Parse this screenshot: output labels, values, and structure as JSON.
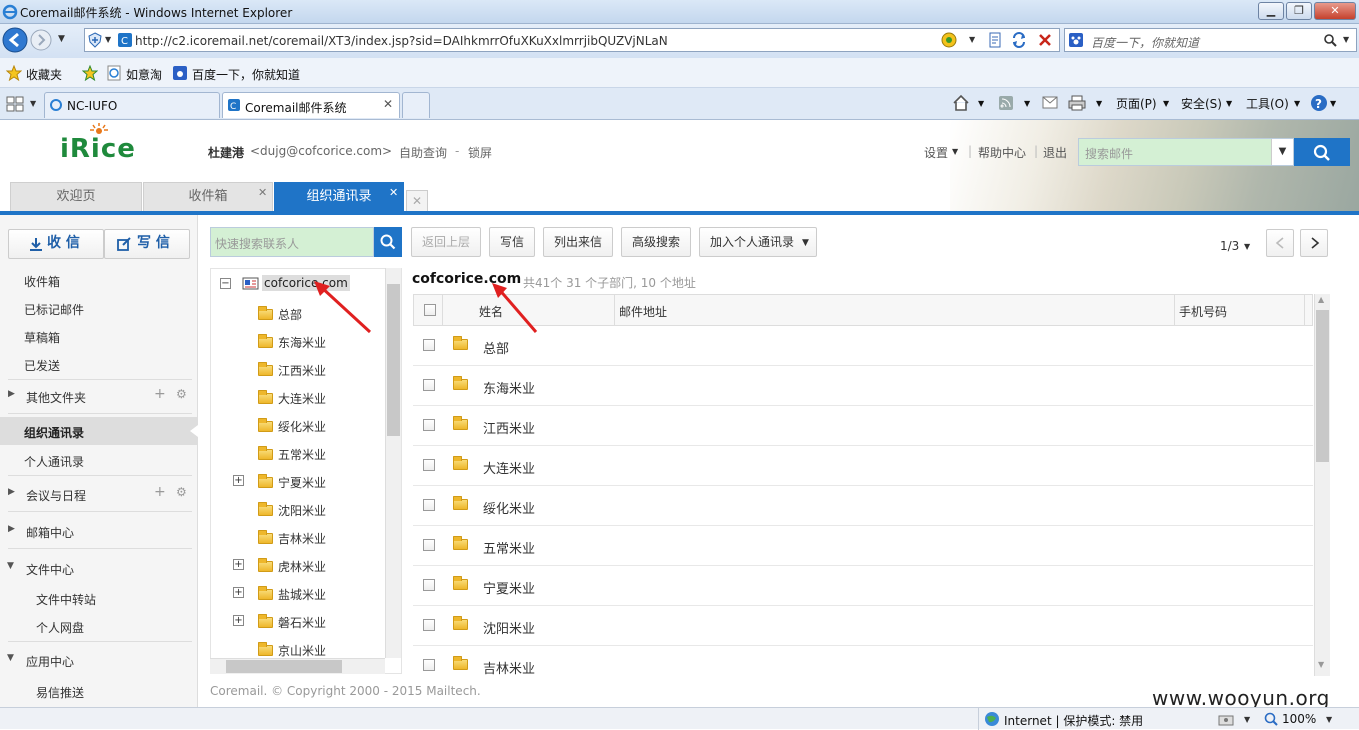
{
  "window": {
    "title": "Coremail邮件系统 - Windows Internet Explorer"
  },
  "browser": {
    "url": "http://c2.icoremail.net/coremail/XT3/index.jsp?sid=DAIhkmrrOfuXKuXxlmrrjibQUZVjNLaN",
    "search_placeholder": "百度一下，你就知道",
    "favorites_label": "收藏夹",
    "fav_links": [
      "如意淘",
      "百度一下，你就知道"
    ],
    "tabs": [
      "NC-IUFO",
      "Coremail邮件系统"
    ],
    "tools": [
      "页面(P)",
      "安全(S)",
      "工具(O)"
    ]
  },
  "header": {
    "logo": "iRice",
    "user_name": "杜建港",
    "user_email": "<dujg@cofcorice.com>",
    "self_help": "自助查询",
    "dash": "-",
    "lock": "锁屏",
    "settings": "设置",
    "help": "帮助中心",
    "logout": "退出",
    "search_placeholder": "搜索邮件"
  },
  "app_tabs": [
    "欢迎页",
    "收件箱",
    "组织通讯录"
  ],
  "sidebar": {
    "receive": "收 信",
    "compose": "写 信",
    "folders": [
      "收件箱",
      "已标记邮件",
      "草稿箱",
      "已发送"
    ],
    "other_folders": "其他文件夹",
    "org_contacts": "组织通讯录",
    "personal_contacts": "个人通讯录",
    "meetings": "会议与日程",
    "mailbox_center": "邮箱中心",
    "file_center": "文件中心",
    "file_items": [
      "文件中转站",
      "个人网盘"
    ],
    "app_center": "应用中心",
    "app_items": [
      "易信推送"
    ]
  },
  "contacts": {
    "search_placeholder": "快速搜索联系人",
    "toolbar": [
      "返回上层",
      "写信",
      "列出来信",
      "高级搜索",
      "加入个人通讯录"
    ],
    "pager": "1/3",
    "tree_root": "cofcorice.com",
    "tree": [
      "总部",
      "东海米业",
      "江西米业",
      "大连米业",
      "绥化米业",
      "五常米业",
      "宁夏米业",
      "沈阳米业",
      "吉林米业",
      "虎林米业",
      "盐城米业",
      "磐石米业",
      "京山米业"
    ],
    "org_name": "cofcorice.com",
    "org_summary": "共41个 31 个子部门, 10 个地址",
    "columns": [
      "姓名",
      "邮件地址",
      "手机号码"
    ],
    "rows": [
      "总部",
      "东海米业",
      "江西米业",
      "大连米业",
      "绥化米业",
      "五常米业",
      "宁夏米业",
      "沈阳米业",
      "吉林米业"
    ]
  },
  "footer": {
    "copyright": "Coremail. © Copyright 2000 - 2015 Mailtech."
  },
  "status": {
    "zone": "Internet | 保护模式: 禁用",
    "zoom": "100%",
    "watermark": "www.wooyun.org"
  }
}
